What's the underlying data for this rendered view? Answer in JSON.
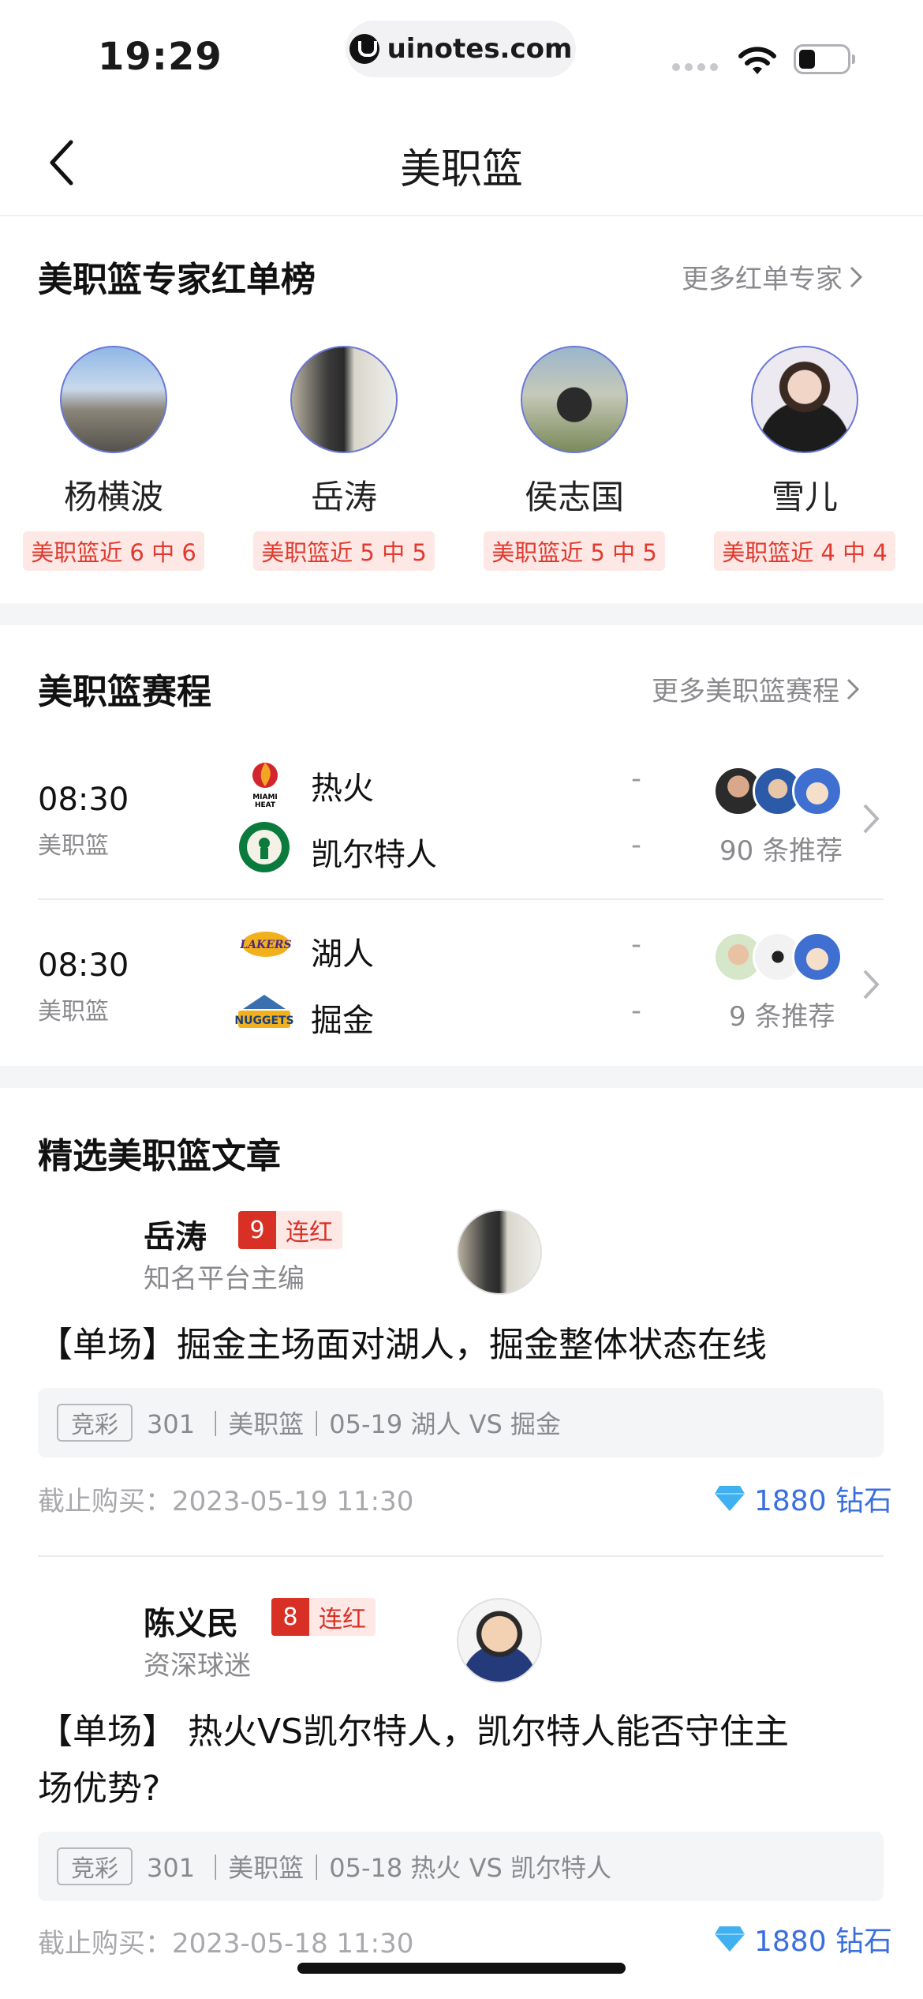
{
  "status_bar": {
    "time": "19:29",
    "url": "uinotes.com"
  },
  "nav": {
    "title": "美职篮"
  },
  "experts_section": {
    "title": "美职篮专家红单榜",
    "more": "更多红单专家",
    "experts": [
      {
        "name": "杨横波",
        "badge": "美职篮近 6 中 6"
      },
      {
        "name": "岳涛",
        "badge": "美职篮近 5 中 5"
      },
      {
        "name": "侯志国",
        "badge": "美职篮近 5 中 5"
      },
      {
        "name": "雪儿",
        "badge": "美职篮近 4 中 4"
      }
    ]
  },
  "schedule_section": {
    "title": "美职篮赛程",
    "more": "更多美职篮赛程",
    "matches": [
      {
        "time": "08:30",
        "league": "美职篮",
        "home": "热火",
        "away": "凯尔特人",
        "home_score": "-",
        "away_score": "-",
        "recommend": "90 条推荐"
      },
      {
        "time": "08:30",
        "league": "美职篮",
        "home": "湖人",
        "away": "掘金",
        "home_score": "-",
        "away_score": "-",
        "recommend": "9 条推荐"
      }
    ]
  },
  "articles_section": {
    "title": "精选美职篮文章",
    "articles": [
      {
        "author": "岳涛",
        "streak": "9",
        "streak_label": "连红",
        "role": "知名平台主编",
        "title": "【单场】掘金主场面对湖人，掘金整体状态在线",
        "tag": "竞彩",
        "info": "301 ｜美职篮｜05-19 湖人 VS 掘金",
        "deadline": "截止购买：2023-05-19 11:30",
        "price": "1880 钻石"
      },
      {
        "author": "陈义民",
        "streak": "8",
        "streak_label": "连红",
        "role": "资深球迷",
        "title_line1": "【单场】 热火VS凯尔特人，凯尔特人能否守住主",
        "title_line2": "场优势?",
        "tag": "竞彩",
        "info": "301 ｜美职篮｜05-18 热火 VS 凯尔特人",
        "deadline": "截止购买：2023-05-18 11:30",
        "price": "1880 钻石"
      }
    ]
  },
  "colors": {
    "accent_red": "#d93025",
    "badge_bg": "#fde8e6",
    "price_blue": "#3a6fe0"
  }
}
